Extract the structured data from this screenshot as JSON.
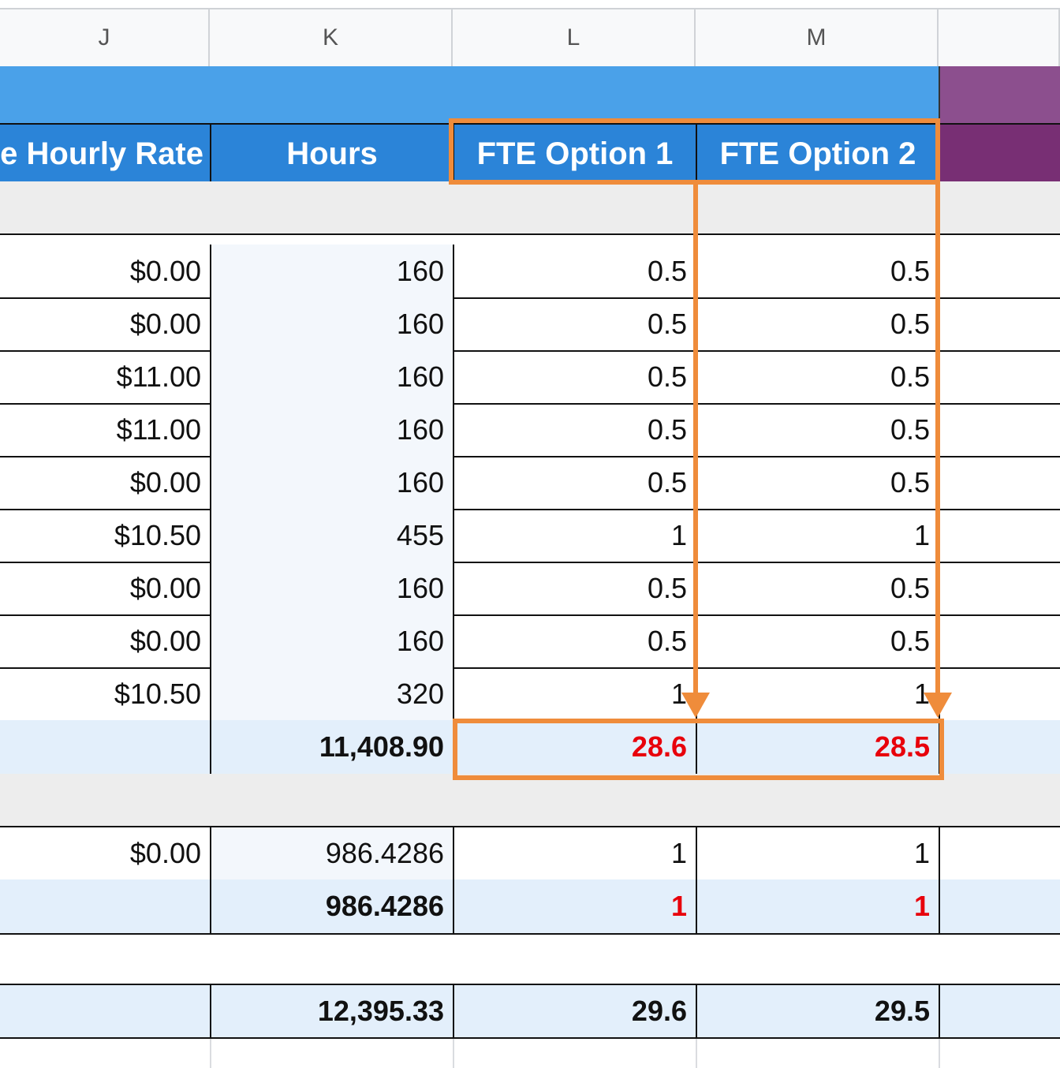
{
  "columns": {
    "j": "J",
    "k": "K",
    "l": "L",
    "m": "M",
    "n": ""
  },
  "header": {
    "hourly_rate": "e Hourly Rate",
    "hours": "Hours",
    "fte_option_1": "FTE Option 1",
    "fte_option_2": "FTE Option 2"
  },
  "section1_rows": [
    {
      "rate": "$0.00",
      "hours": "160",
      "fte1": "0.5",
      "fte2": "0.5"
    },
    {
      "rate": "$0.00",
      "hours": "160",
      "fte1": "0.5",
      "fte2": "0.5"
    },
    {
      "rate": "$11.00",
      "hours": "160",
      "fte1": "0.5",
      "fte2": "0.5"
    },
    {
      "rate": "$11.00",
      "hours": "160",
      "fte1": "0.5",
      "fte2": "0.5"
    },
    {
      "rate": "$0.00",
      "hours": "160",
      "fte1": "0.5",
      "fte2": "0.5"
    },
    {
      "rate": "$10.50",
      "hours": "455",
      "fte1": "1",
      "fte2": "1"
    },
    {
      "rate": "$0.00",
      "hours": "160",
      "fte1": "0.5",
      "fte2": "0.5"
    },
    {
      "rate": "$0.00",
      "hours": "160",
      "fte1": "0.5",
      "fte2": "0.5"
    },
    {
      "rate": "$10.50",
      "hours": "320",
      "fte1": "1",
      "fte2": "1"
    }
  ],
  "section1_subtotal": {
    "hours": "11,408.90",
    "fte1": "28.6",
    "fte2": "28.5"
  },
  "section2_row": {
    "rate": "$0.00",
    "hours": "986.4286",
    "fte1": "1",
    "fte2": "1"
  },
  "section2_subtotal": {
    "hours": "986.4286",
    "fte1": "1",
    "fte2": "1"
  },
  "grand_total": {
    "hours": "12,395.33",
    "fte1": "29.6",
    "fte2": "29.5"
  },
  "colors": {
    "annotation": "#ef8c3b",
    "header_blue": "#2b84d8",
    "banner_blue": "#4aa1e9",
    "purple": "#782f74",
    "alert_red": "#e8000b"
  }
}
